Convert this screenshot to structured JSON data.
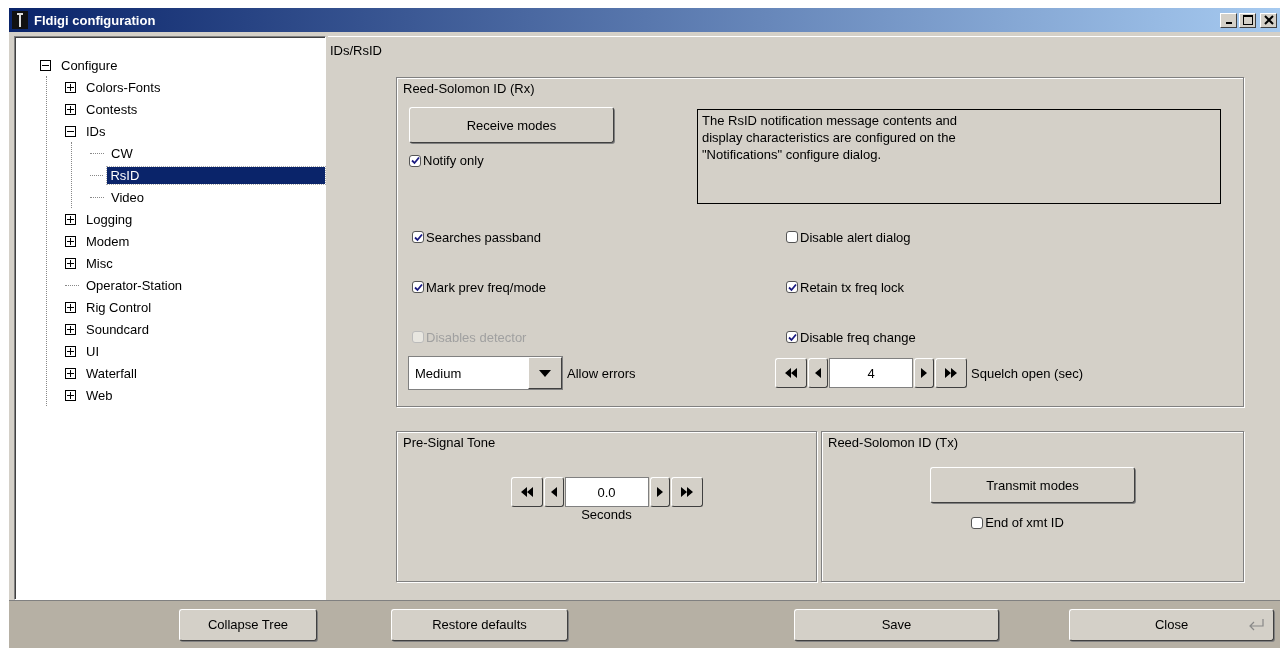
{
  "window": {
    "title": "Fldigi configuration"
  },
  "tree": {
    "items": [
      {
        "label": "Configure",
        "kind": "branch",
        "expanded": true,
        "selected": false,
        "children": [
          {
            "label": "Colors-Fonts",
            "kind": "branch",
            "expanded": false,
            "selected": false
          },
          {
            "label": "Contests",
            "kind": "branch",
            "expanded": false,
            "selected": false
          },
          {
            "label": "IDs",
            "kind": "branch",
            "expanded": true,
            "selected": false,
            "children": [
              {
                "label": "CW",
                "kind": "leaf",
                "selected": false
              },
              {
                "label": "RsID",
                "kind": "leaf",
                "selected": true
              },
              {
                "label": "Video",
                "kind": "leaf",
                "selected": false
              }
            ]
          },
          {
            "label": "Logging",
            "kind": "branch",
            "expanded": false,
            "selected": false
          },
          {
            "label": "Modem",
            "kind": "branch",
            "expanded": false,
            "selected": false
          },
          {
            "label": "Misc",
            "kind": "branch",
            "expanded": false,
            "selected": false
          },
          {
            "label": "Operator-Station",
            "kind": "leaf",
            "selected": false
          },
          {
            "label": "Rig Control",
            "kind": "branch",
            "expanded": false,
            "selected": false
          },
          {
            "label": "Soundcard",
            "kind": "branch",
            "expanded": false,
            "selected": false
          },
          {
            "label": "UI",
            "kind": "branch",
            "expanded": false,
            "selected": false
          },
          {
            "label": "Waterfall",
            "kind": "branch",
            "expanded": false,
            "selected": false
          },
          {
            "label": "Web",
            "kind": "branch",
            "expanded": false,
            "selected": false
          }
        ]
      }
    ]
  },
  "panel": {
    "title": "IDs/RsID"
  },
  "rx_group": {
    "title": "Reed-Solomon ID (Rx)",
    "button": "Receive modes",
    "note_lines": [
      "The RsID notification message contents and",
      "display characteristics are configured on the",
      "\"Notifications\" configure dialog."
    ],
    "notify": {
      "label": "Notify only",
      "checked": true
    },
    "checkboxes": [
      {
        "label": "Searches passband",
        "checked": true,
        "disabled": false
      },
      {
        "label": "Disable alert dialog",
        "checked": false,
        "disabled": false
      },
      {
        "label": "Mark prev freq/mode",
        "checked": true,
        "disabled": false
      },
      {
        "label": "Retain tx freq lock",
        "checked": true,
        "disabled": false
      },
      {
        "label": "Disables detector",
        "checked": false,
        "disabled": true
      },
      {
        "label": "Disable freq change",
        "checked": true,
        "disabled": false
      }
    ],
    "errors": {
      "value": "Medium",
      "label": "Allow errors"
    },
    "squelch": {
      "value": "4",
      "label": "Squelch open (sec)"
    }
  },
  "pre_signal_tone": {
    "title": "Pre-Signal Tone",
    "value": "0.0",
    "unit": "Seconds"
  },
  "tx_group": {
    "title": "Reed-Solomon ID (Tx)",
    "button": "Transmit modes",
    "end_of_xmt": {
      "label": "End of xmt ID",
      "checked": false
    }
  },
  "buttons": {
    "collapse": "Collapse Tree",
    "restore": "Restore defaults",
    "save": "Save",
    "close": "Close"
  }
}
